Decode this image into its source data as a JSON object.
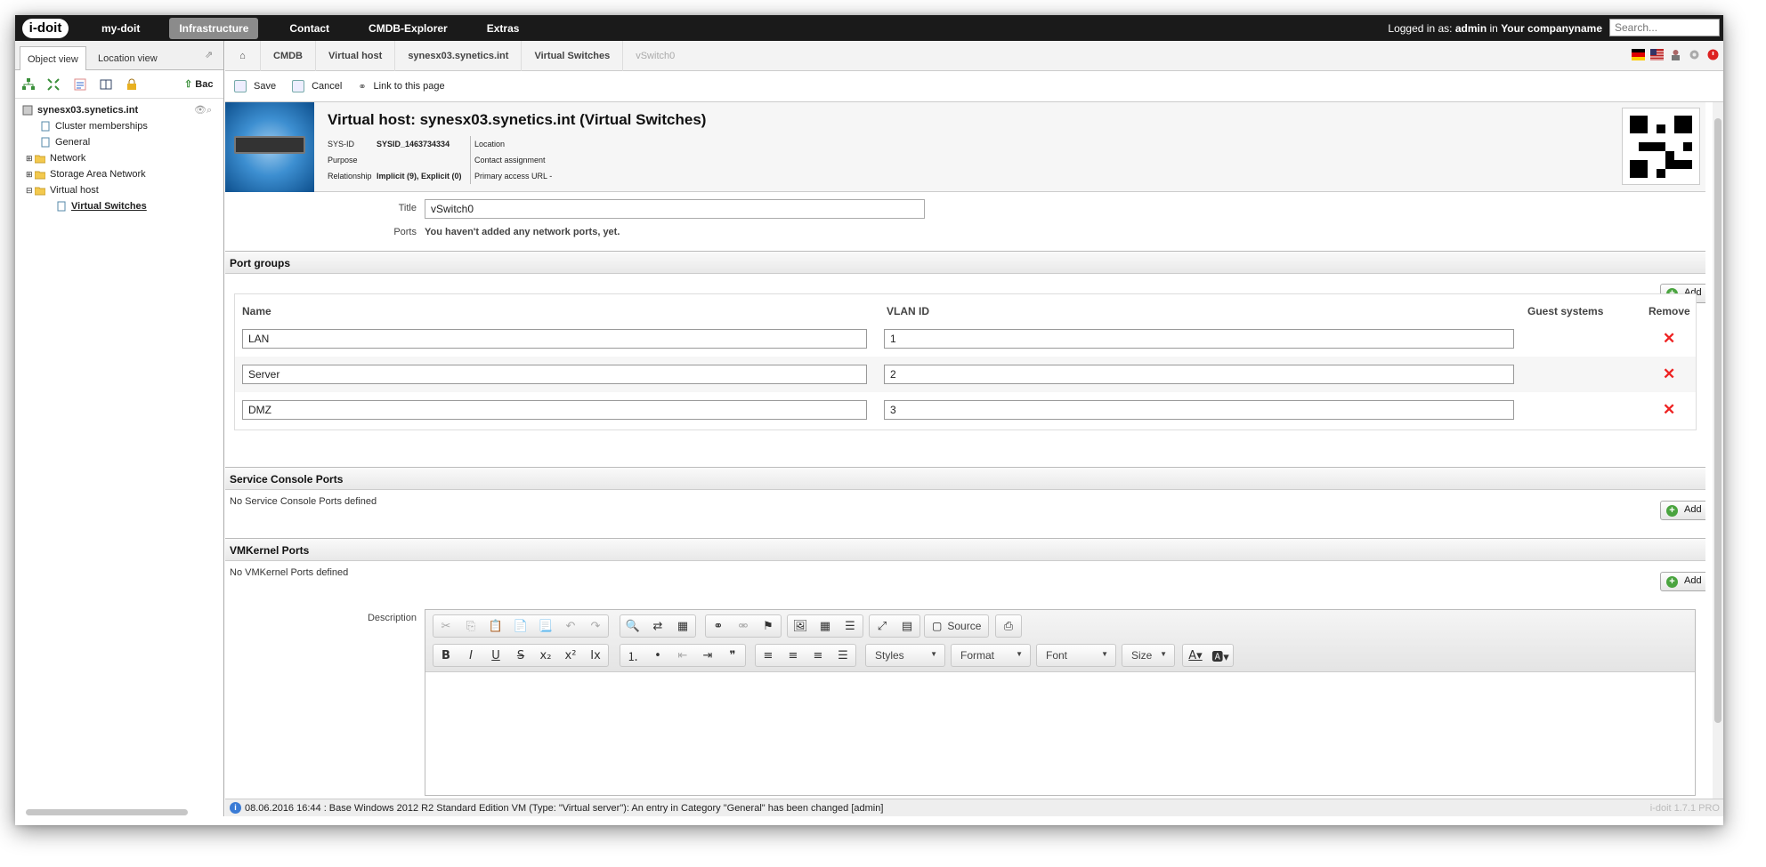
{
  "topnav": {
    "logo": "i-doit",
    "items": [
      "my-doit",
      "Infrastructure",
      "Contact",
      "CMDB-Explorer",
      "Extras"
    ],
    "active": "Infrastructure",
    "login_prefix": "Logged in as:",
    "user": "admin",
    "in_word": "in",
    "company": "Your companyname",
    "search_placeholder": "Search..."
  },
  "left": {
    "tabs": [
      "Object view",
      "Location view"
    ],
    "back_label": "Bac",
    "tree": {
      "root": "synesx03.synetics.int",
      "items": [
        "Cluster memberships",
        "General",
        "Network",
        "Storage Area Network",
        "Virtual host",
        "Virtual Switches"
      ]
    }
  },
  "breadcrumb": [
    "CMDB",
    "Virtual host",
    "synesx03.synetics.int",
    "Virtual Switches",
    "vSwitch0"
  ],
  "actions": {
    "save": "Save",
    "cancel": "Cancel",
    "link": "Link to this page"
  },
  "header": {
    "title": "Virtual host: synesx03.synetics.int (Virtual Switches)",
    "sysid_label": "SYS-ID",
    "sysid_value": "SYSID_1463734334",
    "purpose_label": "Purpose",
    "relationship_label": "Relationship",
    "relationship_value": "Implicit (9), Explicit (0)",
    "location_label": "Location",
    "contact_label": "Contact assignment",
    "access_label": "Primary access URL",
    "access_value": "-"
  },
  "form": {
    "title_label": "Title",
    "title_value": "vSwitch0",
    "ports_label": "Ports",
    "ports_value": "You haven't added any network ports, yet."
  },
  "port_groups": {
    "heading": "Port groups",
    "add_label": "Add",
    "columns": [
      "Name",
      "VLAN ID",
      "Guest systems",
      "Remove"
    ],
    "rows": [
      {
        "name": "LAN",
        "vlan": "1"
      },
      {
        "name": "Server",
        "vlan": "2"
      },
      {
        "name": "DMZ",
        "vlan": "3"
      }
    ]
  },
  "service_console": {
    "heading": "Service Console Ports",
    "empty": "No Service Console Ports defined",
    "add_label": "Add"
  },
  "vmkernel": {
    "heading": "VMKernel Ports",
    "empty": "No VMKernel Ports defined",
    "add_label": "Add"
  },
  "description": {
    "label": "Description",
    "source_label": "Source",
    "styles": "Styles",
    "format": "Format",
    "font": "Font",
    "size": "Size"
  },
  "status": {
    "message": "08.06.2016 16:44 : Base Windows 2012 R2 Standard Edition VM (Type: \"Virtual server\"): An entry in Category \"General\" has been changed [admin]",
    "version": "i-doit 1.7.1 PRO"
  },
  "colors": {
    "topbar": "#1a1a1a",
    "nav_active": "#8b8b8b",
    "remove": "#e22222",
    "add_green": "#4aa43f"
  }
}
